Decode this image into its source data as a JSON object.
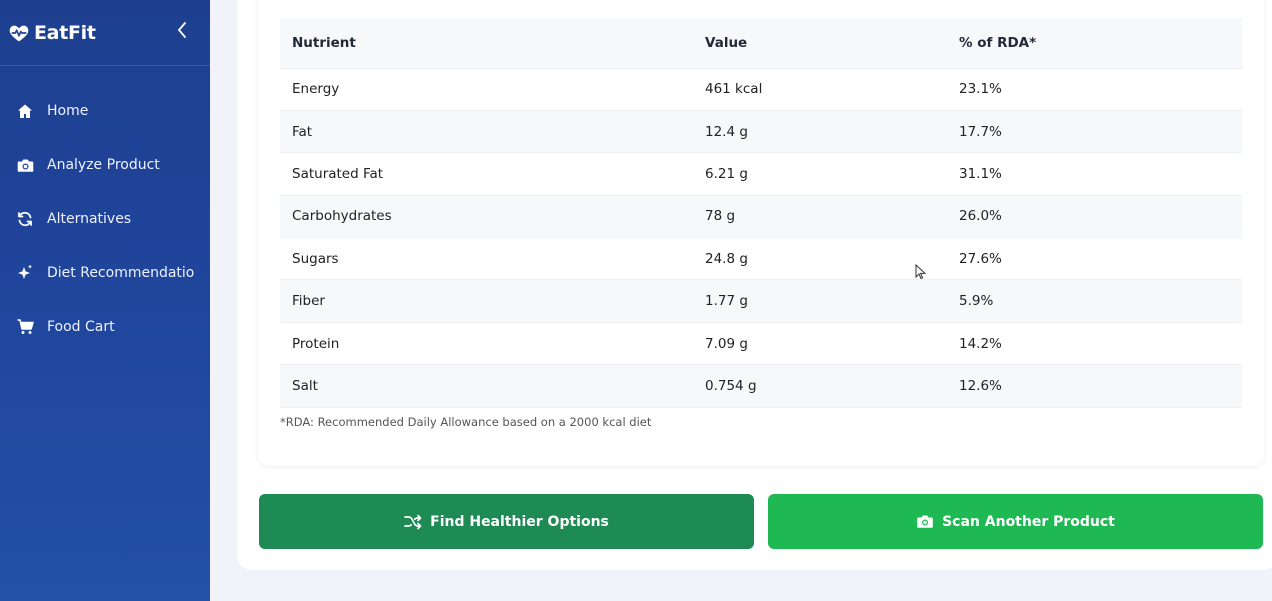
{
  "app": {
    "name": "EatFit"
  },
  "sidebar": {
    "items": [
      {
        "label": "Home",
        "icon": "home-icon"
      },
      {
        "label": "Analyze Product",
        "icon": "camera-icon"
      },
      {
        "label": "Alternatives",
        "icon": "refresh-icon"
      },
      {
        "label": "Diet Recommendatio",
        "icon": "sparkles-icon"
      },
      {
        "label": "Food Cart",
        "icon": "cart-icon"
      }
    ]
  },
  "nutrition_table": {
    "headers": [
      "Nutrient",
      "Value",
      "% of RDA*"
    ],
    "rows": [
      [
        "Energy",
        "461 kcal",
        "23.1%"
      ],
      [
        "Fat",
        "12.4 g",
        "17.7%"
      ],
      [
        "Saturated Fat",
        "6.21 g",
        "31.1%"
      ],
      [
        "Carbohydrates",
        "78 g",
        "26.0%"
      ],
      [
        "Sugars",
        "24.8 g",
        "27.6%"
      ],
      [
        "Fiber",
        "1.77 g",
        "5.9%"
      ],
      [
        "Protein",
        "7.09 g",
        "14.2%"
      ],
      [
        "Salt",
        "0.754 g",
        "12.6%"
      ]
    ],
    "footnote": "*RDA: Recommended Daily Allowance based on a 2000 kcal diet"
  },
  "actions": {
    "healthier_label": "Find Healthier Options",
    "scan_label": "Scan Another Product"
  },
  "colors": {
    "sidebar": "#1f449a",
    "healthier_button": "#1e8a54",
    "scan_button": "#1fb954"
  }
}
